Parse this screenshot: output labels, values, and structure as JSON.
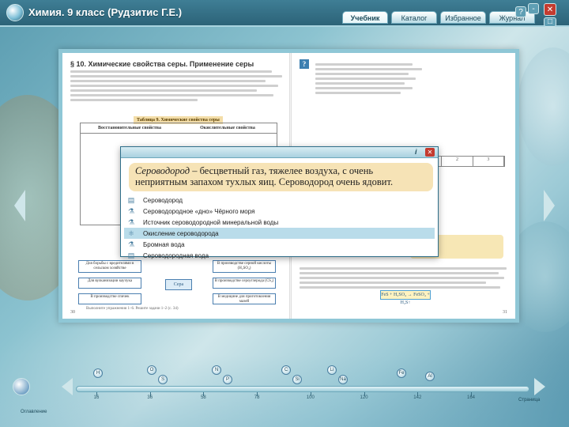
{
  "window": {
    "title": "Химия. 9 класс (Рудзитис Г.Е.)"
  },
  "tabs": [
    {
      "label": "Учебник",
      "active": true
    },
    {
      "label": "Каталог",
      "active": false
    },
    {
      "label": "Избранное",
      "active": false
    },
    {
      "label": "Журнал",
      "active": false
    }
  ],
  "window_buttons": {
    "help": "?",
    "min": "-",
    "close": "✕",
    "max": "□"
  },
  "book": {
    "section_title": "§ 10.  Химические свойства серы. Применение серы",
    "table_caption": "Таблица 9.  Химические свойства серы",
    "table_headers": [
      "Восстановительные свойства",
      "Окислительные свойства"
    ],
    "diagram_center": "Сера",
    "diagram_boxes": [
      "Для борьбы с вредителями в сельском хозяйстве",
      "Для вулканизации каучука",
      "В производстве спичек",
      "В производстве серной кислоты (H₂SO₄)",
      "В производстве сероуглерода (CS₂)",
      "В медицине для приготовления мазей"
    ],
    "exercise_line": "Выполните упражнения 1–6. Решите задачи 1–2 (с. 34)",
    "page_left": "30",
    "page_right": "31",
    "equation": "FeS + H₂SO₄ → FeSO₄ + H₂S↑"
  },
  "popup": {
    "info_label": "i",
    "close_label": "✕",
    "term": "Сероводород",
    "definition": "– бесцветный газ, тяжелее воздуха, с очень неприятным запахом тухлых яиц. Сероводород очень ядовит.",
    "items": [
      {
        "label": "Сероводород",
        "icon": "document-icon",
        "glyph": "▤",
        "selected": false
      },
      {
        "label": "Сероводородное «дно» Чёрного моря",
        "icon": "flask-icon",
        "glyph": "⚗",
        "selected": false
      },
      {
        "label": "Источник сероводородной минеральной воды",
        "icon": "flask-icon",
        "glyph": "⚗",
        "selected": false
      },
      {
        "label": "Окисление сероводорода",
        "icon": "molecule-icon",
        "glyph": "⚛",
        "selected": true
      },
      {
        "label": "Бромная вода",
        "icon": "flask-icon",
        "glyph": "⚗",
        "selected": false
      },
      {
        "label": "Сероводородная вода",
        "icon": "document-icon",
        "glyph": "▤",
        "selected": false
      }
    ]
  },
  "timeline": {
    "labels": [
      "16",
      "36",
      "58",
      "78",
      "100",
      "120",
      "142",
      "164"
    ],
    "molecules": [
      "H",
      "O",
      "S",
      "N",
      "P",
      "C",
      "Si",
      "Li",
      "Na",
      "Fe",
      "Al"
    ],
    "left_label": "Оглавление",
    "right_label": "Страница"
  }
}
